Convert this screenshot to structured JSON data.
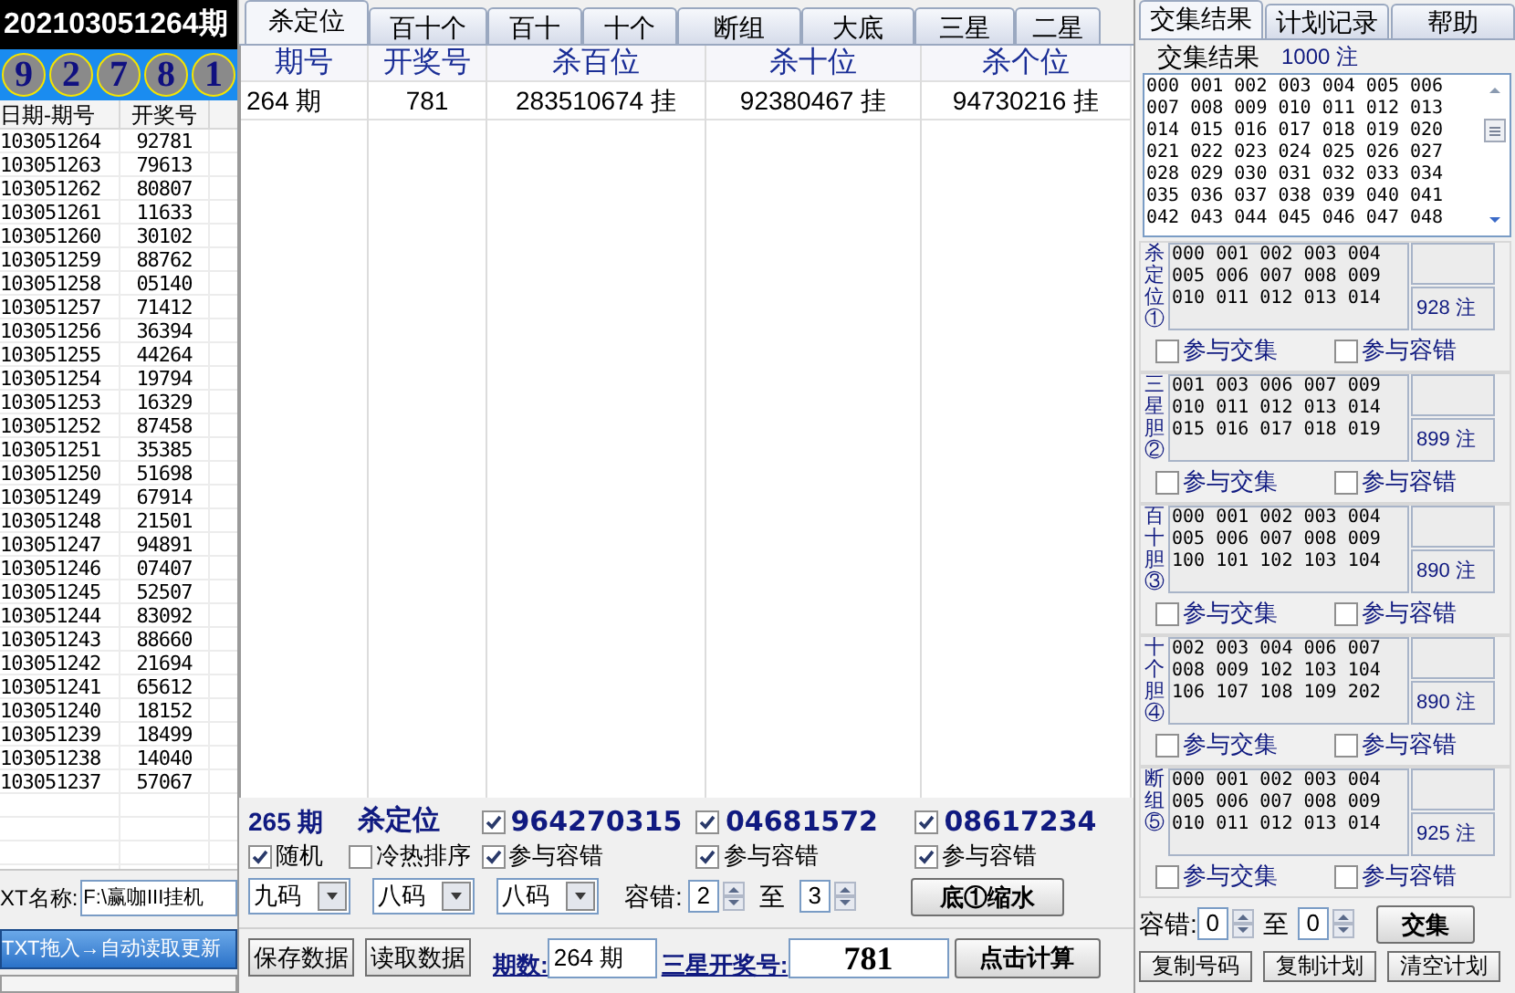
{
  "left": {
    "issue_title": "202103051264期",
    "balls": [
      "9",
      "2",
      "7",
      "8",
      "1"
    ],
    "columns": [
      "日期-期号",
      "开奖号"
    ],
    "rows": [
      [
        "103051264",
        "92781"
      ],
      [
        "103051263",
        "79613"
      ],
      [
        "103051262",
        "80807"
      ],
      [
        "103051261",
        "11633"
      ],
      [
        "103051260",
        "30102"
      ],
      [
        "103051259",
        "88762"
      ],
      [
        "103051258",
        "05140"
      ],
      [
        "103051257",
        "71412"
      ],
      [
        "103051256",
        "36394"
      ],
      [
        "103051255",
        "44264"
      ],
      [
        "103051254",
        "19794"
      ],
      [
        "103051253",
        "16329"
      ],
      [
        "103051252",
        "87458"
      ],
      [
        "103051251",
        "35385"
      ],
      [
        "103051250",
        "51698"
      ],
      [
        "103051249",
        "67914"
      ],
      [
        "103051248",
        "21501"
      ],
      [
        "103051247",
        "94891"
      ],
      [
        "103051246",
        "07407"
      ],
      [
        "103051245",
        "52507"
      ],
      [
        "103051244",
        "83092"
      ],
      [
        "103051243",
        "88660"
      ],
      [
        "103051242",
        "21694"
      ],
      [
        "103051241",
        "65612"
      ],
      [
        "103051240",
        "18152"
      ],
      [
        "103051239",
        "18499"
      ],
      [
        "103051238",
        "14040"
      ],
      [
        "103051237",
        "57067"
      ]
    ],
    "txt_label": "XT名称:",
    "txt_path": "F:\\赢咖III挂机",
    "import_button": "TXT拖入→自动读取更新"
  },
  "tabs": [
    {
      "label": "杀定位",
      "selected": true
    },
    {
      "label": "百十个",
      "selected": false
    },
    {
      "label": "百十",
      "selected": false
    },
    {
      "label": "十个",
      "selected": false
    },
    {
      "label": "断组",
      "selected": false
    },
    {
      "label": "大底",
      "selected": false
    },
    {
      "label": "三星",
      "selected": false
    },
    {
      "label": "二星",
      "selected": false
    }
  ],
  "table": {
    "columns": [
      "期号",
      "开奖号",
      "杀百位",
      "杀十位",
      "杀个位"
    ],
    "rows": [
      [
        "264 期",
        "781",
        "283510674 挂",
        "92380467 挂",
        "94730216 挂"
      ]
    ]
  },
  "controls": {
    "period": "265 期",
    "mode": "杀定位",
    "kill_sets": [
      {
        "checked": true,
        "value": "964270315",
        "tolerance": {
          "label": "参与容错",
          "checked": true
        }
      },
      {
        "checked": true,
        "value": "04681572",
        "tolerance": {
          "label": "参与容错",
          "checked": true
        }
      },
      {
        "checked": true,
        "value": "08617234",
        "tolerance": {
          "label": "参与容错",
          "checked": true
        }
      }
    ],
    "random": {
      "label": "随机",
      "checked": true
    },
    "hot_cold": {
      "label": "冷热排序",
      "checked": false
    },
    "selects": [
      "九码",
      "八码",
      "八码"
    ],
    "tolerance_label": "容错:",
    "from": "2",
    "to_label": "至",
    "to": "3",
    "shrink_button": "底①缩水",
    "save_button": "保存数据",
    "load_button": "读取数据",
    "periods_label": "期数:",
    "periods_value": "264 期",
    "draw_label": "三星开奖号:",
    "draw_value": "781",
    "calc_button": "点击计算"
  },
  "right": {
    "tabs": [
      {
        "label": "交集结果",
        "selected": true
      },
      {
        "label": "计划记录",
        "selected": false
      },
      {
        "label": "帮助",
        "selected": false
      }
    ],
    "result_label": "交集结果",
    "result_count": "1000 注",
    "result_numbers": [
      "000 001 002 003 004 005 006",
      "007 008 009 010 011 012 013",
      "014 015 016 017 018 019 020",
      "021 022 023 024 025 026 027",
      "028 029 030 031 032 033 034",
      "035 036 037 038 039 040 041",
      "042 043 044 045 046 047 048"
    ],
    "groups": [
      {
        "title": "杀定位①",
        "numbers": [
          "000 001 002 003 004",
          "005 006 007 008 009",
          "010 011 012 013 014"
        ],
        "count": "928 注",
        "intersect": {
          "label": "参与交集",
          "checked": false
        },
        "tolerance": {
          "label": "参与容错",
          "checked": false
        }
      },
      {
        "title": "三星胆②",
        "numbers": [
          "001 003 006 007 009",
          "010 011 012 013 014",
          "015 016 017 018 019"
        ],
        "count": "899 注",
        "intersect": {
          "label": "参与交集",
          "checked": false
        },
        "tolerance": {
          "label": "参与容错",
          "checked": false
        }
      },
      {
        "title": "百十胆③",
        "numbers": [
          "000 001 002 003 004",
          "005 006 007 008 009",
          "100 101 102 103 104"
        ],
        "count": "890 注",
        "intersect": {
          "label": "参与交集",
          "checked": false
        },
        "tolerance": {
          "label": "参与容错",
          "checked": false
        }
      },
      {
        "title": "十个胆④",
        "numbers": [
          "002 003 004 006 007",
          "008 009 102 103 104",
          "106 107 108 109 202"
        ],
        "count": "890 注",
        "intersect": {
          "label": "参与交集",
          "checked": false
        },
        "tolerance": {
          "label": "参与容错",
          "checked": false
        }
      },
      {
        "title": "断组⑤",
        "numbers": [
          "000 001 002 003 004",
          "005 006 007 008 009",
          "010 011 012 013 014"
        ],
        "count": "925 注",
        "intersect": {
          "label": "参与交集",
          "checked": false
        },
        "tolerance": {
          "label": "参与容错",
          "checked": false
        }
      }
    ],
    "tolerance_label": "容错:",
    "from": "0",
    "to_label": "至",
    "to": "0",
    "intersect_button": "交集",
    "buttons": [
      "复制号码",
      "复制计划",
      "清空计划"
    ]
  }
}
